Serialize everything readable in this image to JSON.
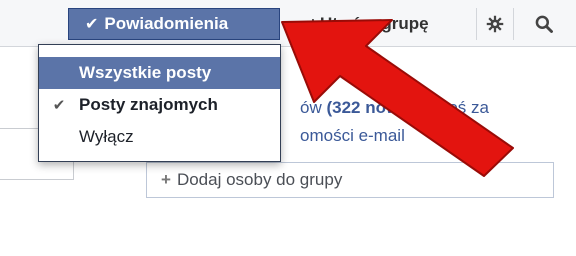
{
  "topbar": {
    "notifications_label": "Powiadomienia",
    "create_group_label": "Utwórz grupę"
  },
  "dropdown": {
    "items": [
      {
        "label": "Wszystkie posty",
        "state": "highlighted"
      },
      {
        "label": "Posty znajomych",
        "state": "checked"
      },
      {
        "label": "Wyłącz",
        "state": "normal"
      }
    ]
  },
  "content": {
    "line1_prefix": "ów",
    "line1_bold": "(322 now",
    "line1_suffix": "proś za",
    "line2": "omości e-mail",
    "add_people": "Dodaj osoby do grupy"
  },
  "colors": {
    "accent": "#5b74a8",
    "arrow": "#e3140f",
    "link": "#3b5998"
  }
}
